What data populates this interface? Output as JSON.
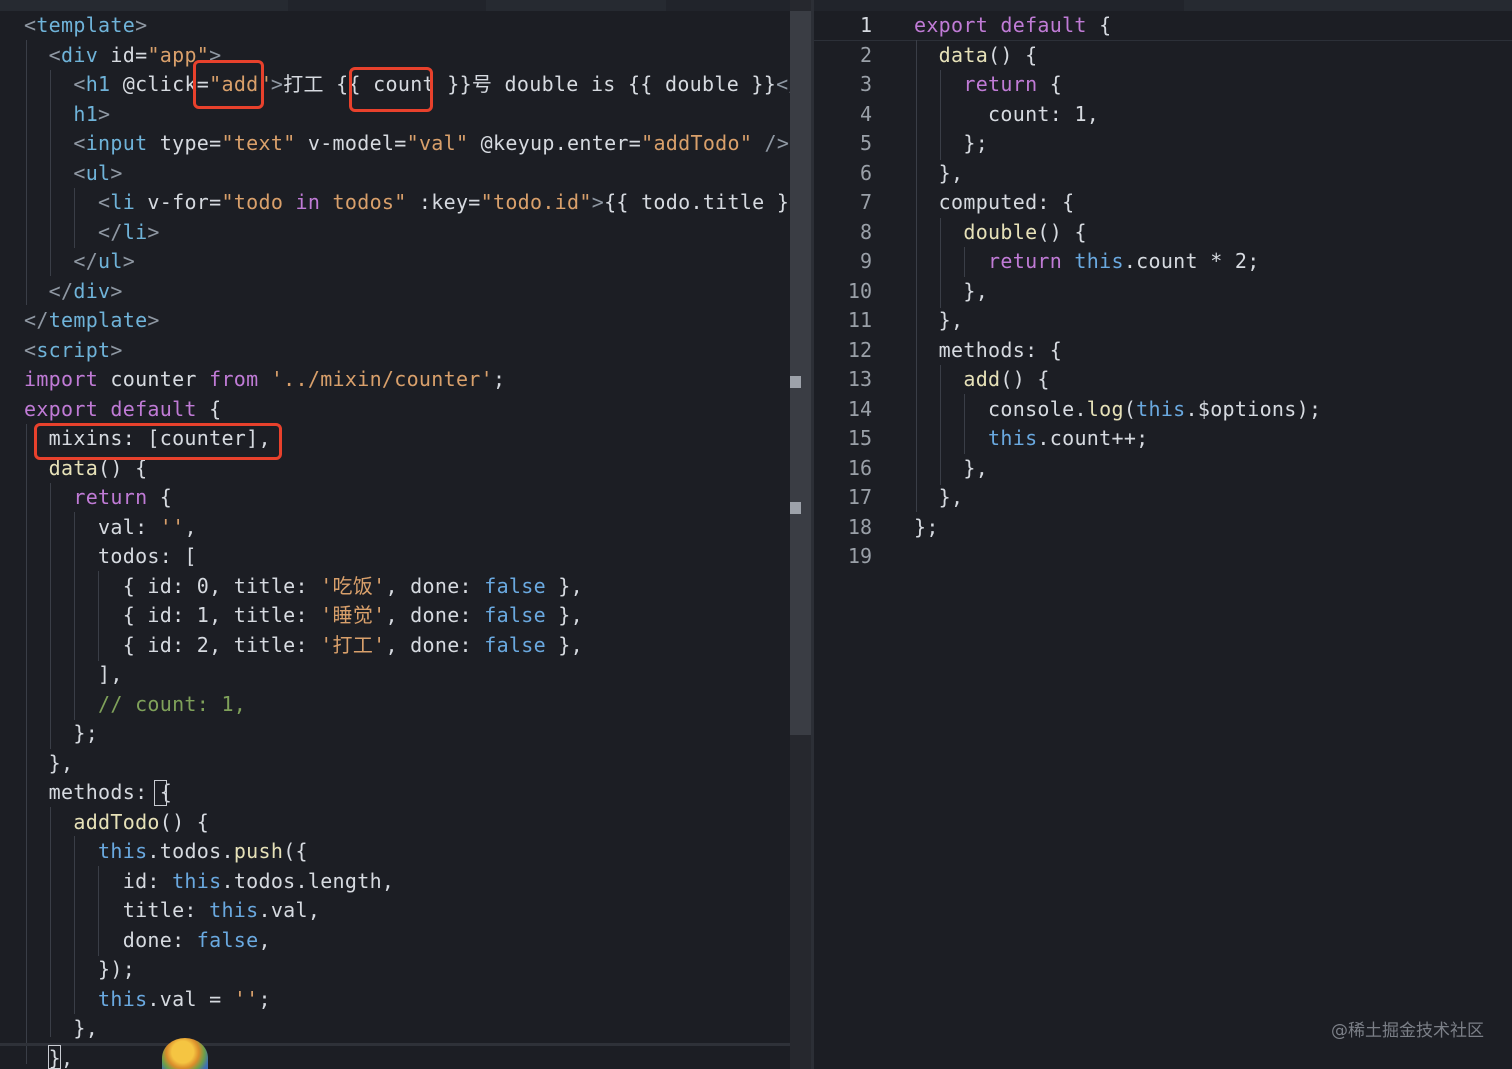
{
  "left_editor": {
    "lines": [
      [
        [
          "t",
          "<"
        ],
        [
          "n",
          "template"
        ],
        [
          "t",
          ">"
        ]
      ],
      [
        [
          "t",
          "  <"
        ],
        [
          "n",
          "div"
        ],
        [
          "a",
          " id="
        ],
        [
          "s",
          "\"app\""
        ],
        [
          "t",
          ">"
        ]
      ],
      [
        [
          "t",
          "    <"
        ],
        [
          "n",
          "h1"
        ],
        [
          "a",
          " @click="
        ],
        [
          "s",
          "\"add\""
        ],
        [
          "t",
          ">"
        ],
        [
          "p",
          "打工 {{ "
        ],
        [
          "a",
          "count"
        ],
        [
          "p",
          " }}号 double is {{ double }}"
        ],
        [
          "t",
          "</"
        ]
      ],
      [
        [
          "n",
          "    h1"
        ],
        [
          "t",
          ">"
        ]
      ],
      [
        [
          "t",
          "    <"
        ],
        [
          "n",
          "input"
        ],
        [
          "a",
          " type="
        ],
        [
          "s",
          "\"text\""
        ],
        [
          "a",
          " v-model="
        ],
        [
          "s",
          "\"val\""
        ],
        [
          "a",
          " @keyup.enter="
        ],
        [
          "s",
          "\"addTodo\""
        ],
        [
          "t",
          " />"
        ]
      ],
      [
        [
          "t",
          "    <"
        ],
        [
          "n",
          "ul"
        ],
        [
          "t",
          ">"
        ]
      ],
      [
        [
          "t",
          "      <"
        ],
        [
          "n",
          "li"
        ],
        [
          "a",
          " v-for="
        ],
        [
          "s",
          "\"todo "
        ],
        [
          "k",
          "in"
        ],
        [
          "s",
          " todos\""
        ],
        [
          "a",
          " :key="
        ],
        [
          "s",
          "\"todo.id\""
        ],
        [
          "t",
          ">"
        ],
        [
          "p",
          "{{ todo.title }}"
        ]
      ],
      [
        [
          "t",
          "      </"
        ],
        [
          "n",
          "li"
        ],
        [
          "t",
          ">"
        ]
      ],
      [
        [
          "t",
          "    </"
        ],
        [
          "n",
          "ul"
        ],
        [
          "t",
          ">"
        ]
      ],
      [
        [
          "t",
          "  </"
        ],
        [
          "n",
          "div"
        ],
        [
          "t",
          ">"
        ]
      ],
      [
        [
          "t",
          "</"
        ],
        [
          "n",
          "template"
        ],
        [
          "t",
          ">"
        ]
      ],
      [
        [
          "t",
          "<"
        ],
        [
          "n",
          "script"
        ],
        [
          "t",
          ">"
        ]
      ],
      [
        [
          "k",
          "import"
        ],
        [
          "a",
          " counter "
        ],
        [
          "k",
          "from"
        ],
        [
          "s",
          " '../mixin/counter'"
        ],
        [
          "p",
          ";"
        ]
      ],
      [
        [
          "k",
          "export default"
        ],
        [
          "p",
          " {"
        ]
      ],
      [
        [
          "a",
          "  mixins: [counter],"
        ]
      ],
      [
        [
          "f",
          "  data"
        ],
        [
          "p",
          "() {"
        ]
      ],
      [
        [
          "k",
          "    return"
        ],
        [
          "p",
          " {"
        ]
      ],
      [
        [
          "a",
          "      val: "
        ],
        [
          "s",
          "''"
        ],
        [
          "p",
          ","
        ]
      ],
      [
        [
          "a",
          "      todos: ["
        ]
      ],
      [
        [
          "p",
          "        { id: "
        ],
        [
          "a",
          "0"
        ],
        [
          "p",
          ", title: "
        ],
        [
          "s",
          "'吃饭'"
        ],
        [
          "p",
          ", done: "
        ],
        [
          "b",
          "false"
        ],
        [
          "p",
          " },"
        ]
      ],
      [
        [
          "p",
          "        { id: "
        ],
        [
          "a",
          "1"
        ],
        [
          "p",
          ", title: "
        ],
        [
          "s",
          "'睡觉'"
        ],
        [
          "p",
          ", done: "
        ],
        [
          "b",
          "false"
        ],
        [
          "p",
          " },"
        ]
      ],
      [
        [
          "p",
          "        { id: "
        ],
        [
          "a",
          "2"
        ],
        [
          "p",
          ", title: "
        ],
        [
          "s",
          "'打工'"
        ],
        [
          "p",
          ", done: "
        ],
        [
          "b",
          "false"
        ],
        [
          "p",
          " },"
        ]
      ],
      [
        [
          "p",
          "      ],"
        ]
      ],
      [
        [
          "c",
          "      // count: 1,"
        ]
      ],
      [
        [
          "p",
          "    };"
        ]
      ],
      [
        [
          "p",
          "  },"
        ]
      ],
      [
        [
          "a",
          "  methods: "
        ],
        [
          "p",
          "{"
        ]
      ],
      [
        [
          "f",
          "    addTodo"
        ],
        [
          "p",
          "() {"
        ]
      ],
      [
        [
          "b",
          "      this"
        ],
        [
          "p",
          "."
        ],
        [
          "a",
          "todos"
        ],
        [
          "p",
          "."
        ],
        [
          "f",
          "push"
        ],
        [
          "p",
          "({"
        ]
      ],
      [
        [
          "a",
          "        id: "
        ],
        [
          "b",
          "this"
        ],
        [
          "p",
          "."
        ],
        [
          "a",
          "todos"
        ],
        [
          "p",
          "."
        ],
        [
          "a",
          "length"
        ],
        [
          "p",
          ","
        ]
      ],
      [
        [
          "a",
          "        title: "
        ],
        [
          "b",
          "this"
        ],
        [
          "p",
          "."
        ],
        [
          "a",
          "val"
        ],
        [
          "p",
          ","
        ]
      ],
      [
        [
          "a",
          "        done: "
        ],
        [
          "b",
          "false"
        ],
        [
          "p",
          ","
        ]
      ],
      [
        [
          "p",
          "      });"
        ]
      ],
      [
        [
          "b",
          "      this"
        ],
        [
          "p",
          "."
        ],
        [
          "a",
          "val"
        ],
        [
          "p",
          " = "
        ],
        [
          "s",
          "''"
        ],
        [
          "p",
          ";"
        ]
      ],
      [
        [
          "p",
          "    },"
        ]
      ],
      [
        [
          "p",
          "  },"
        ]
      ]
    ]
  },
  "right_editor": {
    "line_numbers": [
      "1",
      "2",
      "3",
      "4",
      "5",
      "6",
      "7",
      "8",
      "9",
      "10",
      "11",
      "12",
      "13",
      "14",
      "15",
      "16",
      "17",
      "18",
      "19"
    ],
    "lines": [
      [
        [
          "k",
          "export default"
        ],
        [
          "p",
          " {"
        ]
      ],
      [
        [
          "f",
          "  data"
        ],
        [
          "p",
          "() {"
        ]
      ],
      [
        [
          "k",
          "    return"
        ],
        [
          "p",
          " {"
        ]
      ],
      [
        [
          "a",
          "      count: "
        ],
        [
          "a",
          "1"
        ],
        [
          "p",
          ","
        ]
      ],
      [
        [
          "p",
          "    };"
        ]
      ],
      [
        [
          "p",
          "  },"
        ]
      ],
      [
        [
          "a",
          "  computed: "
        ],
        [
          "p",
          "{"
        ]
      ],
      [
        [
          "f",
          "    double"
        ],
        [
          "p",
          "() {"
        ]
      ],
      [
        [
          "k",
          "      return"
        ],
        [
          "b",
          " this"
        ],
        [
          "p",
          "."
        ],
        [
          "a",
          "count"
        ],
        [
          "p",
          " * "
        ],
        [
          "a",
          "2"
        ],
        [
          "p",
          ";"
        ]
      ],
      [
        [
          "p",
          "    },"
        ]
      ],
      [
        [
          "p",
          "  },"
        ]
      ],
      [
        [
          "a",
          "  methods: "
        ],
        [
          "p",
          "{"
        ]
      ],
      [
        [
          "f",
          "    add"
        ],
        [
          "p",
          "() {"
        ]
      ],
      [
        [
          "a",
          "      console"
        ],
        [
          "p",
          "."
        ],
        [
          "f",
          "log"
        ],
        [
          "p",
          "("
        ],
        [
          "b",
          "this"
        ],
        [
          "p",
          "."
        ],
        [
          "a",
          "$options"
        ],
        [
          "p",
          ");"
        ]
      ],
      [
        [
          "b",
          "      this"
        ],
        [
          "p",
          "."
        ],
        [
          "a",
          "count"
        ],
        [
          "p",
          "++;"
        ]
      ],
      [
        [
          "p",
          "    },"
        ]
      ],
      [
        [
          "p",
          "  },"
        ]
      ],
      [
        [
          "p",
          "};"
        ]
      ],
      [
        [
          "p",
          ""
        ]
      ]
    ]
  },
  "watermark": "@稀土掘金技术社区",
  "colors": {
    "background": "#1c1e24",
    "highlight_box": "#e8412c"
  }
}
